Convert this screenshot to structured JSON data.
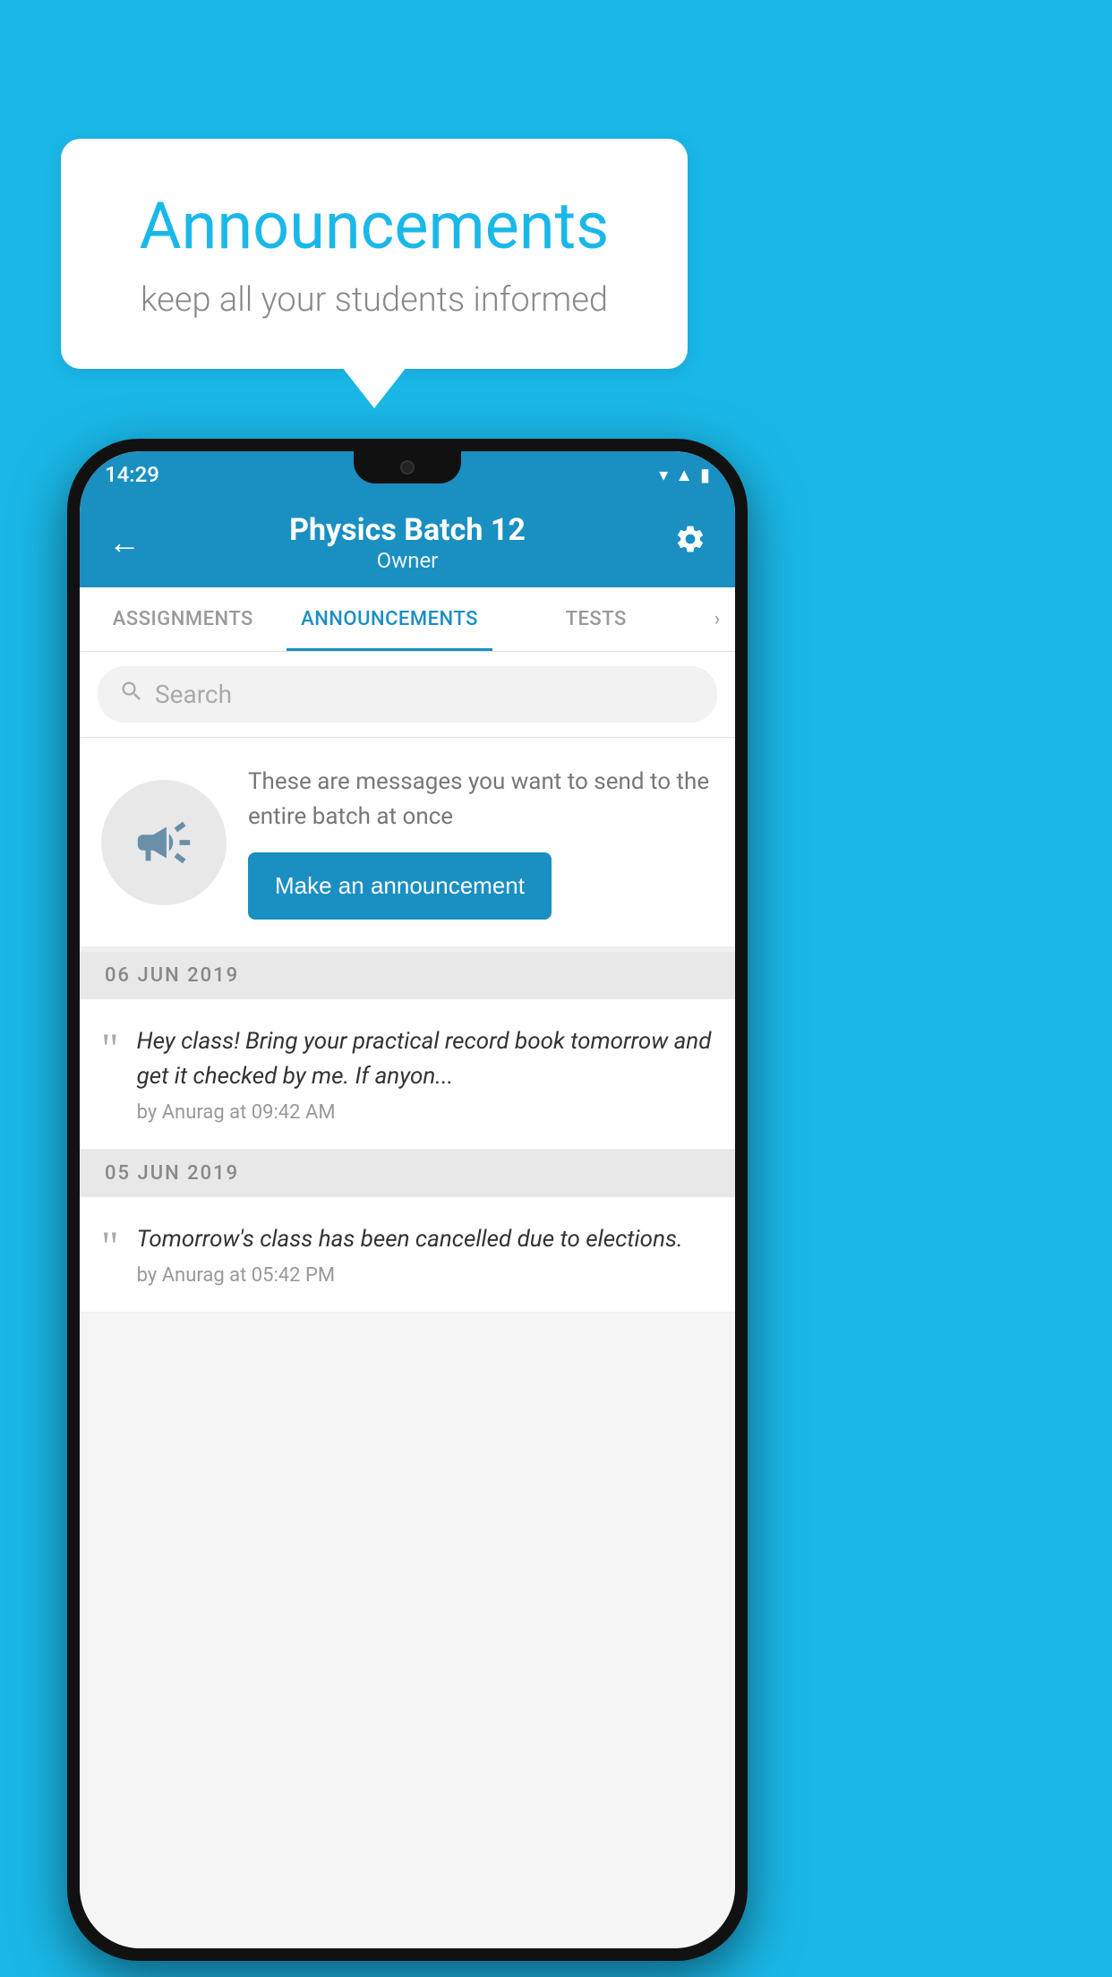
{
  "background_color": "#1ab8e8",
  "speech_bubble": {
    "title": "Announcements",
    "subtitle": "keep all your students informed"
  },
  "phone": {
    "status_bar": {
      "time": "14:29",
      "wifi": "▼",
      "signal": "▲",
      "battery": "▮"
    },
    "app_bar": {
      "title": "Physics Batch 12",
      "subtitle": "Owner",
      "back_label": "←",
      "settings_label": "⚙"
    },
    "tabs": [
      {
        "label": "ASSIGNMENTS",
        "active": false
      },
      {
        "label": "ANNOUNCEMENTS",
        "active": true
      },
      {
        "label": "TESTS",
        "active": false
      }
    ],
    "search": {
      "placeholder": "Search"
    },
    "promo": {
      "text": "These are messages you want to send to the entire batch at once",
      "button_label": "Make an announcement"
    },
    "announcements": [
      {
        "date": "06  JUN  2019",
        "text": "Hey class! Bring your practical record book tomorrow and get it checked by me. If anyon...",
        "meta": "by Anurag at 09:42 AM"
      },
      {
        "date": "05  JUN  2019",
        "text": "Tomorrow's class has been cancelled due to elections.",
        "meta": "by Anurag at 05:42 PM"
      }
    ]
  }
}
